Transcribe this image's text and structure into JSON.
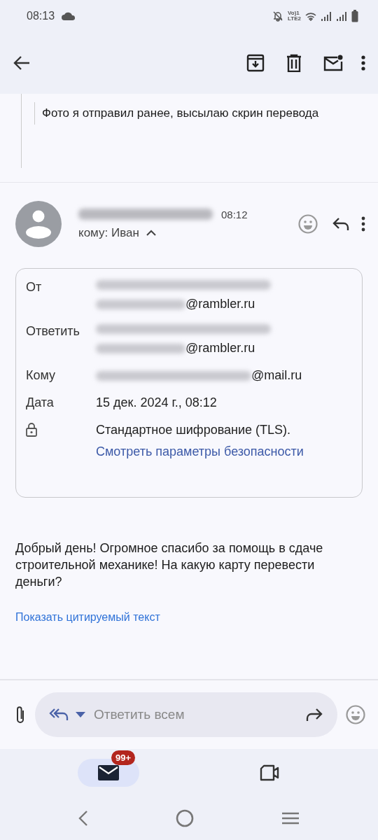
{
  "status_bar": {
    "time": "08:13",
    "network_label": [
      "Vo)1",
      "LTE2"
    ]
  },
  "quoted": {
    "text": "Фото я отправил ранее, высылаю скрин перевода"
  },
  "message": {
    "sender_redacted": true,
    "time": "08:12",
    "recipient": "кому: Иван",
    "details_expanded": true
  },
  "details": [
    {
      "kind": "field",
      "label": "От",
      "redacted": true,
      "value": "@rambler.ru"
    },
    {
      "kind": "field",
      "label": "Ответить",
      "redacted": true,
      "value": "@rambler.ru"
    },
    {
      "kind": "field",
      "label": "Кому",
      "redacted": true,
      "value": "@mail.ru"
    },
    {
      "kind": "field",
      "label": "Дата",
      "redacted": false,
      "value": "15 дек. 2024 г., 08:12"
    },
    {
      "kind": "security",
      "value": "Стандартное шифрование (TLS).",
      "link": "Смотреть параметры безопасности"
    }
  ],
  "body": "Добрый день! Огромное спасибо за помощь в сдаче строительной механике! На какую карту перевести деньги?",
  "show_quoted_link": "Показать цитируемый текст",
  "reply_bar": {
    "placeholder": "Ответить всем"
  },
  "bottom_nav": [
    {
      "kind": "mail",
      "selected": true,
      "badge": "99+"
    },
    {
      "kind": "video",
      "selected": false
    }
  ]
}
